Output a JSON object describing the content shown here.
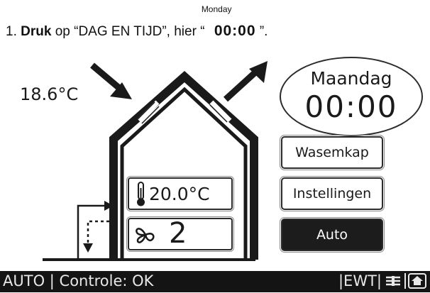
{
  "instruction": {
    "number": "1.",
    "verb": "Druk",
    "text_before": "op “DAG EN TIJD”, hier “",
    "time": "00:00",
    "day_small": "Monday",
    "text_after": "”."
  },
  "display": {
    "outdoor_temp": "18.6°C",
    "clock": {
      "day": "Maandag",
      "time": "00:00"
    },
    "indoor_temp": "20.0°C",
    "fan_level": "2",
    "buttons": {
      "hood": "Wasemkap",
      "settings": "Instellingen",
      "auto": "Auto"
    },
    "status_bar": {
      "mode": "AUTO",
      "separator": "|",
      "status": "Controle: OK",
      "ewt": "|EWT|",
      "icons": [
        "filter-icon",
        "home-icon"
      ]
    }
  }
}
